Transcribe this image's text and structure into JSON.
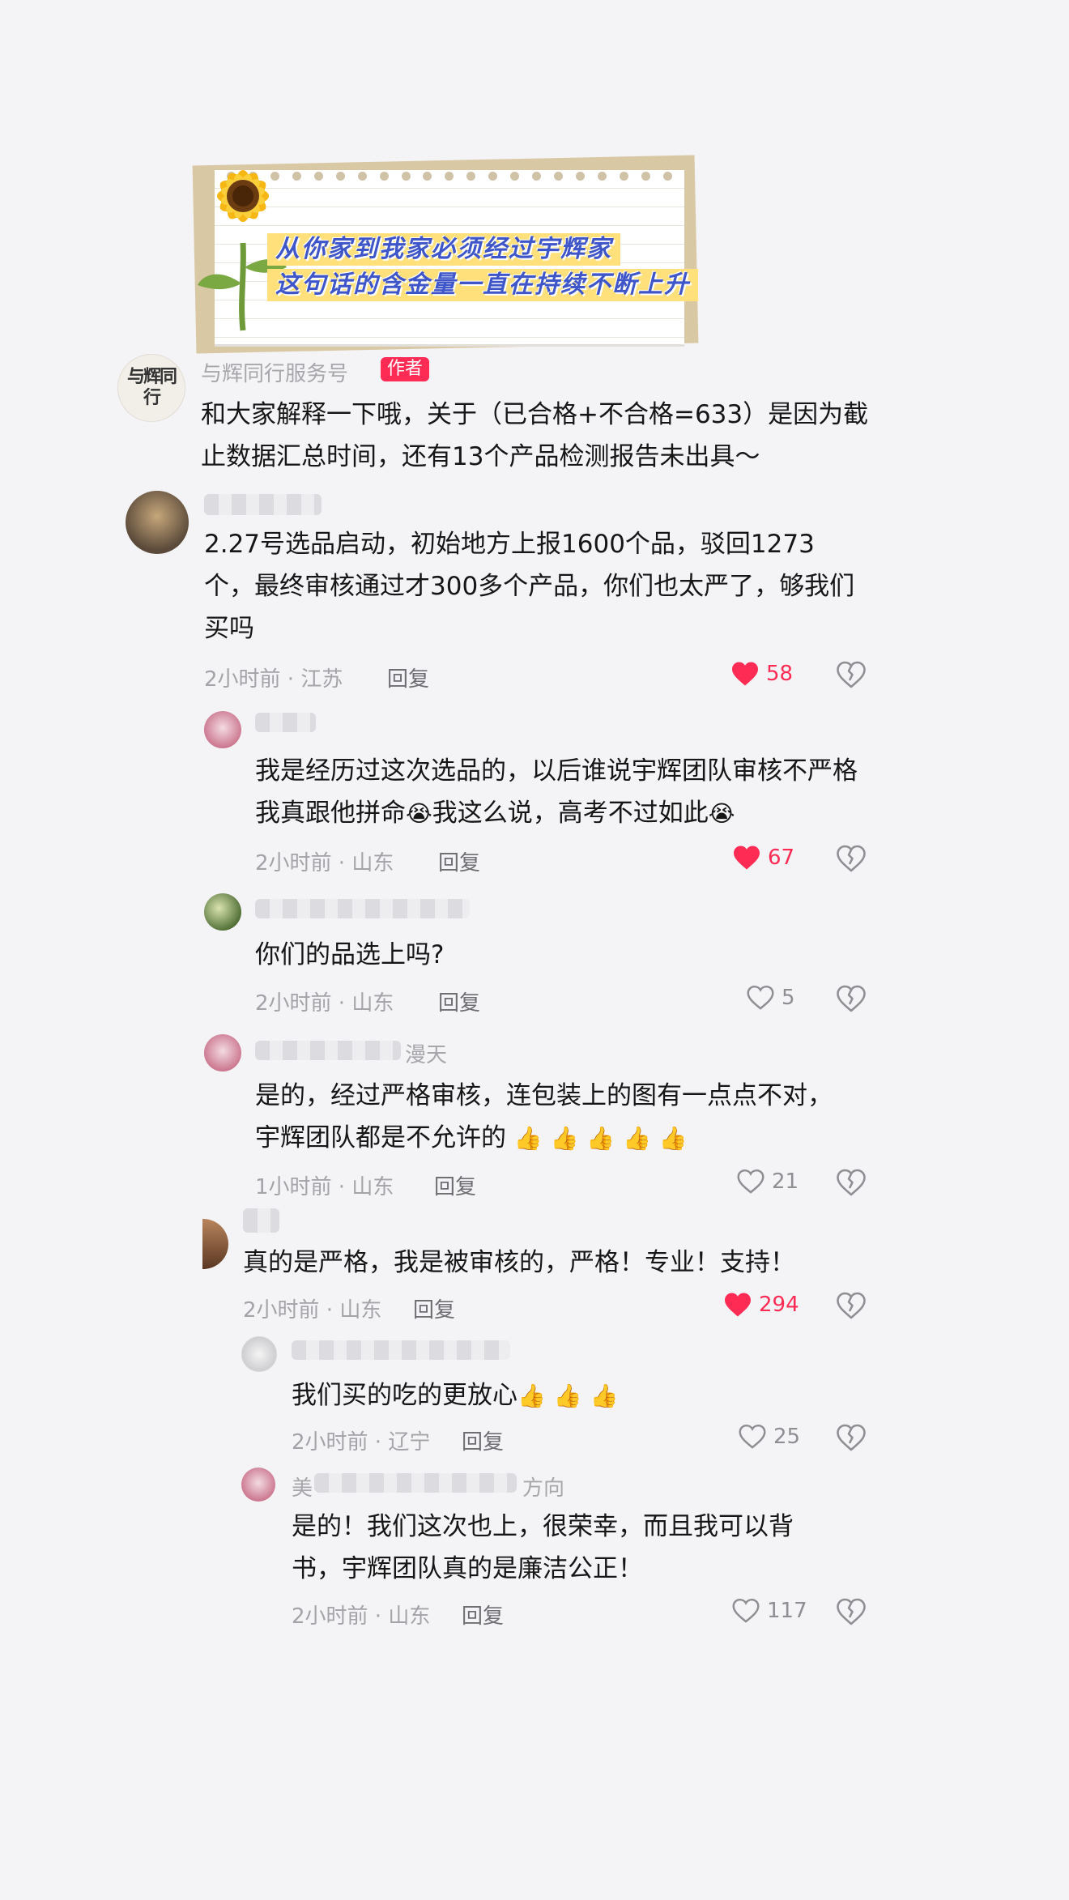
{
  "banner": {
    "line1": "从你家到我家必须经过宇辉家",
    "line2": "这句话的含金量一直在持续不断上升"
  },
  "author_comment": {
    "username": "与辉同行服务号",
    "author_badge": "作者",
    "avatar_text": "与辉同行",
    "text": "和大家解释一下哦，关于（已合格+不合格=633）是因为截止数据汇总时间，还有13个产品检测报告未出具～"
  },
  "comments": [
    {
      "text": "2.27号选品启动，初始地方上报1600个品，驳回1273个，最终审核通过才300多个产品，你们也太严了，够我们买吗",
      "meta": "2小时前 · 江苏",
      "reply": "回复",
      "likes": "58",
      "liked": true
    },
    {
      "text_a": "我是经历过这次选品的，以后谁说宇辉团队审核不严格我真跟他拼命",
      "text_b": "我这么说，高考不过如此",
      "emoji": "😭",
      "meta": "2小时前 · 山东",
      "reply": "回复",
      "likes": "67",
      "liked": true
    },
    {
      "text": "你们的品选上吗?",
      "meta": "2小时前 · 山东",
      "reply": "回复",
      "likes": "5",
      "liked": false
    },
    {
      "name_suffix": "漫天",
      "text": "是的，经过严格审核，连包装上的图有一点点不对，宇辉团队都是不允许的",
      "emoji": "👍",
      "meta": "1小时前 · 山东",
      "reply": "回复",
      "likes": "21",
      "liked": false
    },
    {
      "text": "真的是严格，我是被审核的，严格！专业！支持！",
      "meta": "2小时前 · 山东",
      "reply": "回复",
      "likes": "294",
      "liked": true
    },
    {
      "text": "我们买的吃的更放心",
      "emoji": "👍",
      "meta": "2小时前 · 辽宁",
      "reply": "回复",
      "likes": "25",
      "liked": false
    },
    {
      "name_prefix": "美",
      "name_suffix": "方向",
      "text": "是的！我们这次也上，很荣幸，而且我可以背书，宇辉团队真的是廉洁公正！",
      "meta": "2小时前 · 山东",
      "reply": "回复",
      "likes": "117",
      "liked": false
    }
  ],
  "colors": {
    "accent": "#fe2c55",
    "meta": "#a3a3a8",
    "banner_text": "#3f56c9",
    "banner_highlight": "#ffe07a"
  },
  "icons": [
    "heart-icon",
    "heart-outline-icon",
    "broken-heart-icon",
    "sunflower-icon"
  ]
}
